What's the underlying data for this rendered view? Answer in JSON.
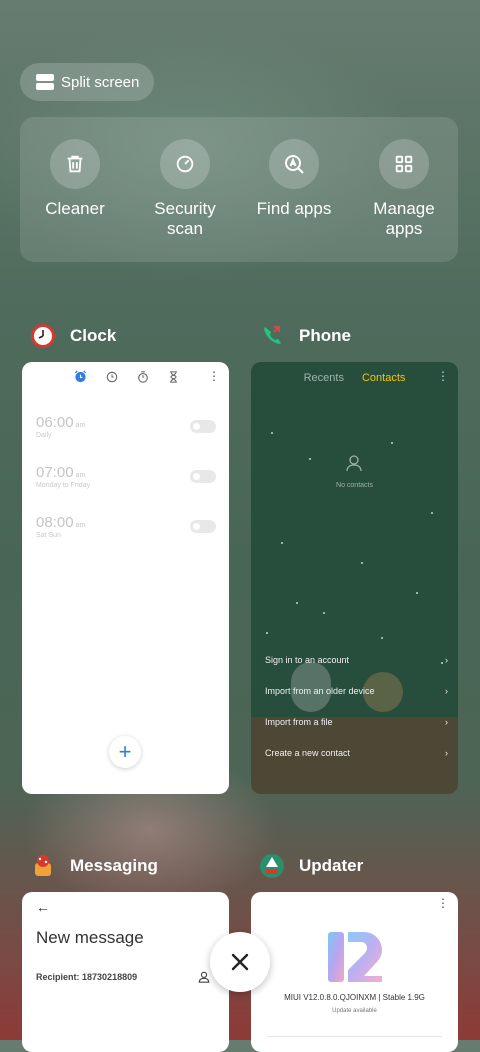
{
  "split_screen": {
    "label": "Split screen"
  },
  "quick_actions": [
    {
      "label": "Cleaner",
      "icon": "trash-icon"
    },
    {
      "label": "Security\nscan",
      "icon": "scan-icon"
    },
    {
      "label": "Find apps",
      "icon": "find-apps-icon"
    },
    {
      "label": "Manage\napps",
      "icon": "grid-icon"
    }
  ],
  "apps": {
    "clock": {
      "name": "Clock",
      "alarms": [
        {
          "time": "06:00",
          "ampm": "am",
          "repeat": "Daily"
        },
        {
          "time": "07:00",
          "ampm": "am",
          "repeat": "Monday to Friday"
        },
        {
          "time": "08:00",
          "ampm": "am",
          "repeat": "Sat Sun"
        }
      ],
      "fab_label": "+"
    },
    "phone": {
      "name": "Phone",
      "tabs": {
        "recents": "Recents",
        "contacts": "Contacts"
      },
      "empty_text": "No contacts",
      "menu": [
        "Sign in to an account",
        "Import from an older device",
        "Import from a file",
        "Create a new contact"
      ]
    },
    "messaging": {
      "name": "Messaging",
      "title": "New message",
      "recipient_label": "Recipient:",
      "recipient_value": "18730218809"
    },
    "updater": {
      "name": "Updater",
      "version": "MIUI V12.0.8.0.QJOINXM | Stable 1.9G",
      "status": "Update available"
    }
  },
  "colors": {
    "contacts_active": "#f5c400",
    "clock_accent": "#2f7de1"
  }
}
